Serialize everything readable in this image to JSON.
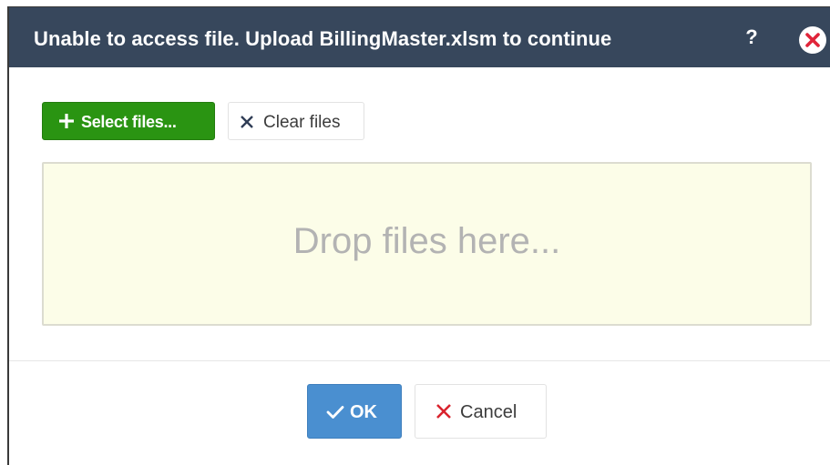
{
  "dialog": {
    "title": "Unable to access file. Upload BillingMaster.xlsm to continue",
    "help_label": "?"
  },
  "toolbar": {
    "select_files_label": "Select files...",
    "clear_files_label": "Clear files"
  },
  "dropzone": {
    "text": "Drop files here..."
  },
  "footer": {
    "ok_label": "OK",
    "cancel_label": "Cancel"
  },
  "colors": {
    "titlebar": "#37475c",
    "select_button": "#2a9412",
    "ok_button": "#4a8fd0",
    "cancel_x": "#d9232d",
    "close_x": "#e0253a",
    "dropzone_bg": "#fcfde8"
  }
}
